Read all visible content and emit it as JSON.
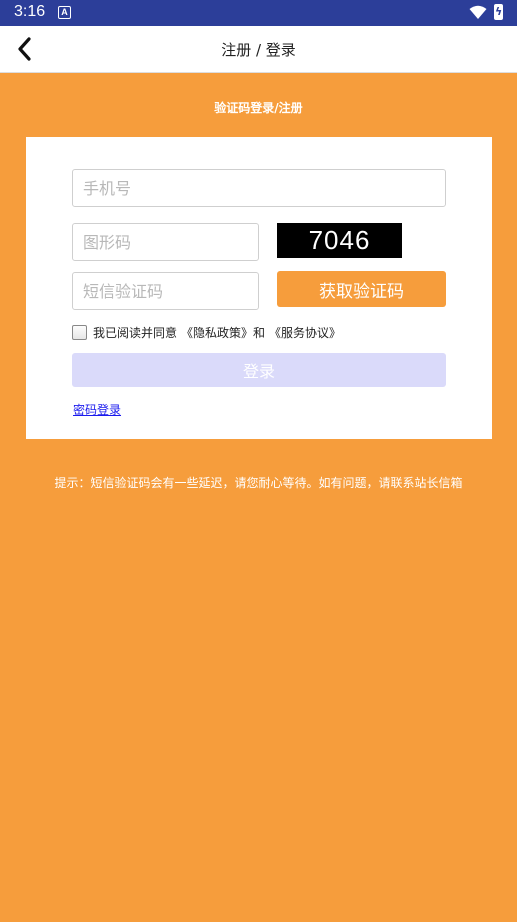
{
  "status_bar": {
    "time": "3:16",
    "notification_icon": "A"
  },
  "app_bar": {
    "title": "注册 / 登录",
    "back_icon": "chevron-left-icon"
  },
  "section_title": "验证码登录/注册",
  "form": {
    "phone_placeholder": "手机号",
    "captcha_placeholder": "图形码",
    "captcha_code": "7046",
    "sms_placeholder": "短信验证码",
    "sms_button": "获取验证码",
    "agree_text": "我已阅读并同意",
    "privacy_link": "《隐私政策》和",
    "service_link": "《服务协议》",
    "login_button": "登录",
    "password_login": "密码登录"
  },
  "hint": "提示：短信验证码会有一些延迟，请您耐心等待。如有问题，请联系站长信箱",
  "colors": {
    "background": "#f69d3c",
    "status_bar": "#2c3e99",
    "login_disabled": "#dadafa",
    "link": "#1a1aee"
  }
}
